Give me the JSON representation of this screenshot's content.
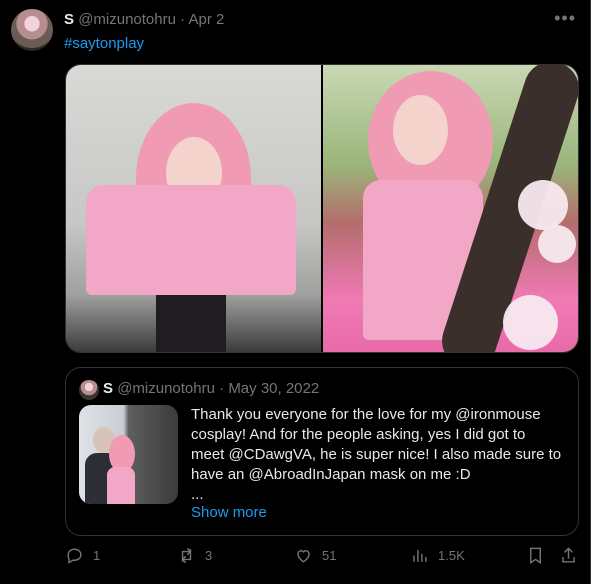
{
  "tweet": {
    "display_name": "S",
    "handle": "@mizunotohru",
    "separator": "·",
    "date": "Apr 2",
    "hashtag": "#saytonplay",
    "more_icon": "more-horizontal-icon"
  },
  "media": {
    "photos": [
      {
        "label": "cosplay-photo-1"
      },
      {
        "label": "cosplay-photo-2"
      }
    ]
  },
  "quote": {
    "display_name": "S",
    "handle": "@mizunotohru",
    "separator": "·",
    "date": "May 30, 2022",
    "text_lines": [
      "Thank you everyone for the love for my @ironmouse",
      "cosplay! And for the people asking, yes I did got to",
      "meet @CDawgVA, he is super nice! I also made sure to",
      "have an @AbroadInJapan mask on me :D",
      "..."
    ],
    "show_more": "Show more"
  },
  "actions": {
    "reply_count": "1",
    "retweet_count": "3",
    "like_count": "51",
    "views_count": "1.5K"
  }
}
